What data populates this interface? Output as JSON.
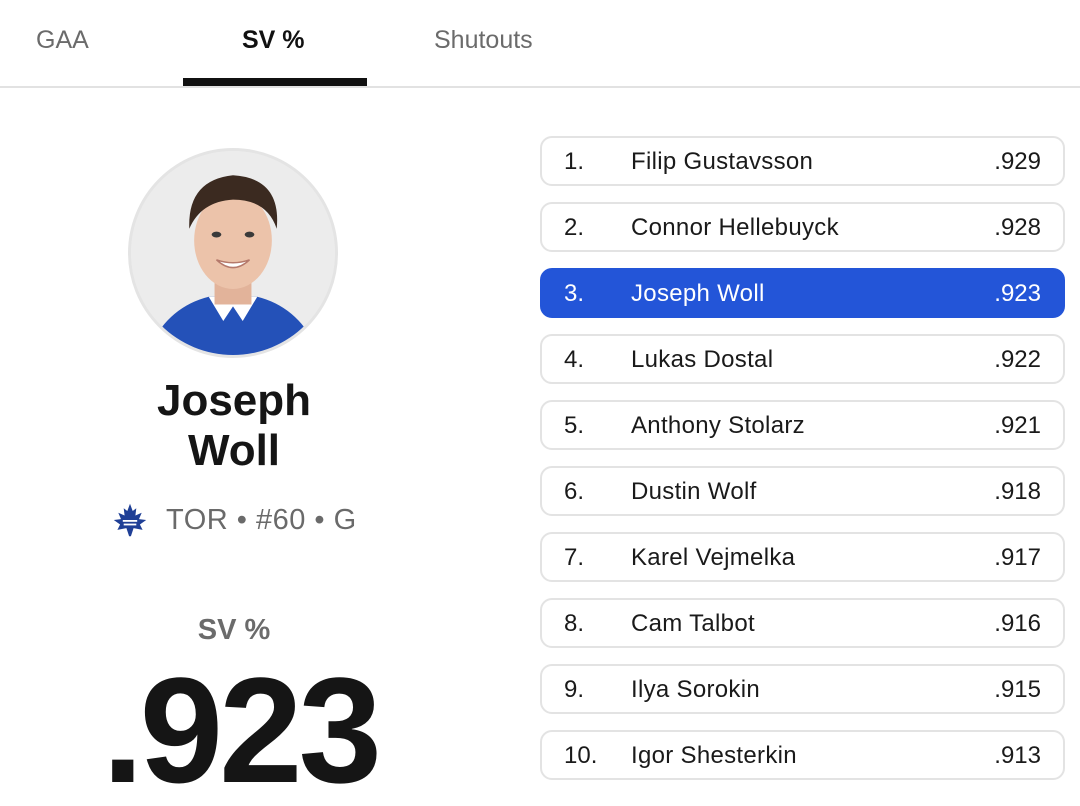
{
  "tabs": [
    {
      "label": "GAA",
      "active": false
    },
    {
      "label": "SV %",
      "active": true
    },
    {
      "label": "Shutouts",
      "active": false
    }
  ],
  "player": {
    "first_name": "Joseph",
    "last_name": "Woll",
    "team_icon": "maple-leaf-icon",
    "meta": "TOR • #60 • G",
    "stat_label": "SV %",
    "stat_value": ".923"
  },
  "colors": {
    "accent": "#2355d8",
    "team_blue": "#1f3f96"
  },
  "leaderboard": [
    {
      "rank": "1.",
      "name": "Filip Gustavsson",
      "value": ".929",
      "highlight": false
    },
    {
      "rank": "2.",
      "name": "Connor Hellebuyck",
      "value": ".928",
      "highlight": false
    },
    {
      "rank": "3.",
      "name": "Joseph Woll",
      "value": ".923",
      "highlight": true
    },
    {
      "rank": "4.",
      "name": "Lukas Dostal",
      "value": ".922",
      "highlight": false
    },
    {
      "rank": "5.",
      "name": "Anthony Stolarz",
      "value": ".921",
      "highlight": false
    },
    {
      "rank": "6.",
      "name": "Dustin Wolf",
      "value": ".918",
      "highlight": false
    },
    {
      "rank": "7.",
      "name": "Karel Vejmelka",
      "value": ".917",
      "highlight": false
    },
    {
      "rank": "8.",
      "name": "Cam Talbot",
      "value": ".916",
      "highlight": false
    },
    {
      "rank": "9.",
      "name": "Ilya Sorokin",
      "value": ".915",
      "highlight": false
    },
    {
      "rank": "10.",
      "name": "Igor Shesterkin",
      "value": ".913",
      "highlight": false
    }
  ]
}
